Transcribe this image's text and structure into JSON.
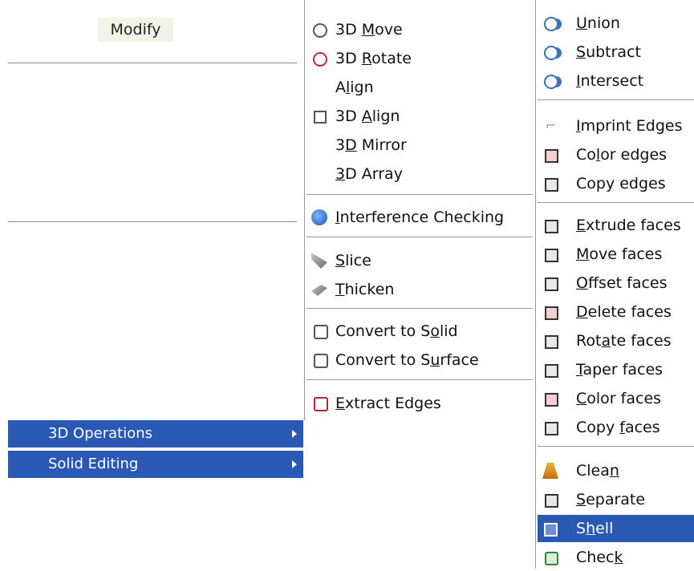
{
  "left_panel": {
    "modify_label": "Modify",
    "items": [
      {
        "label": "3D Operations"
      },
      {
        "label": "Solid Editing"
      }
    ]
  },
  "ops_menu": {
    "items": [
      {
        "label_pre": "3D ",
        "label_u": "M",
        "label_post": "ove",
        "icon": "3d-move-icon"
      },
      {
        "label_pre": "3D ",
        "label_u": "R",
        "label_post": "otate",
        "icon": "3d-rotate-icon"
      },
      {
        "label_pre": "A",
        "label_u": "l",
        "label_post": "ign",
        "icon": ""
      },
      {
        "label_pre": "3D ",
        "label_u": "A",
        "label_post": "lign",
        "icon": "3d-align-icon"
      },
      {
        "label_pre": "3",
        "label_u": "D",
        "label_post": " Mirror",
        "icon": ""
      },
      {
        "label_pre": "",
        "label_u": "3",
        "label_post": "D Array",
        "icon": ""
      },
      {
        "label_pre": "",
        "label_u": "I",
        "label_post": "nterference Checking",
        "icon": "interference-icon"
      },
      {
        "label_pre": "",
        "label_u": "S",
        "label_post": "lice",
        "icon": "slice-icon"
      },
      {
        "label_pre": "",
        "label_u": "T",
        "label_post": "hicken",
        "icon": "thicken-icon"
      },
      {
        "label_pre": "Convert to S",
        "label_u": "o",
        "label_post": "lid",
        "icon": "convert-solid-icon"
      },
      {
        "label_pre": "Convert to S",
        "label_u": "u",
        "label_post": "rface",
        "icon": "convert-surface-icon"
      },
      {
        "label_pre": "",
        "label_u": "E",
        "label_post": "xtract Edges",
        "icon": "extract-edges-icon"
      }
    ]
  },
  "solid_menu": {
    "items": [
      {
        "label_pre": "",
        "label_u": "U",
        "label_post": "nion",
        "icon": "union-icon"
      },
      {
        "label_pre": "",
        "label_u": "S",
        "label_post": "ubtract",
        "icon": "subtract-icon"
      },
      {
        "label_pre": "",
        "label_u": "I",
        "label_post": "ntersect",
        "icon": "intersect-icon"
      },
      {
        "label_pre": "",
        "label_u": "I",
        "label_post": "mprint Edges",
        "icon": "imprint-edges-icon"
      },
      {
        "label_pre": "Co",
        "label_u": "l",
        "label_post": "or edges",
        "icon": "color-edges-icon"
      },
      {
        "label_pre": "Copy ed",
        "label_u": "g",
        "label_post": "es",
        "icon": "copy-edges-icon"
      },
      {
        "label_pre": "",
        "label_u": "E",
        "label_post": "xtrude faces",
        "icon": "extrude-faces-icon"
      },
      {
        "label_pre": "",
        "label_u": "M",
        "label_post": "ove faces",
        "icon": "move-faces-icon"
      },
      {
        "label_pre": "",
        "label_u": "O",
        "label_post": "ffset faces",
        "icon": "offset-faces-icon"
      },
      {
        "label_pre": "",
        "label_u": "D",
        "label_post": "elete faces",
        "icon": "delete-faces-icon"
      },
      {
        "label_pre": "Rot",
        "label_u": "a",
        "label_post": "te faces",
        "icon": "rotate-faces-icon"
      },
      {
        "label_pre": "",
        "label_u": "T",
        "label_post": "aper faces",
        "icon": "taper-faces-icon"
      },
      {
        "label_pre": "",
        "label_u": "C",
        "label_post": "olor faces",
        "icon": "color-faces-icon"
      },
      {
        "label_pre": "Copy ",
        "label_u": "f",
        "label_post": "aces",
        "icon": "copy-faces-icon"
      },
      {
        "label_pre": "Clea",
        "label_u": "n",
        "label_post": "",
        "icon": "clean-icon"
      },
      {
        "label_pre": "",
        "label_u": "S",
        "label_post": "eparate",
        "icon": "separate-icon"
      },
      {
        "label_pre": "S",
        "label_u": "h",
        "label_post": "ell",
        "icon": "shell-icon"
      },
      {
        "label_pre": "Chec",
        "label_u": "k",
        "label_post": "",
        "icon": "check-icon"
      }
    ]
  },
  "colors": {
    "highlight": "#2a59b5",
    "separator": "#9a9a9a"
  }
}
